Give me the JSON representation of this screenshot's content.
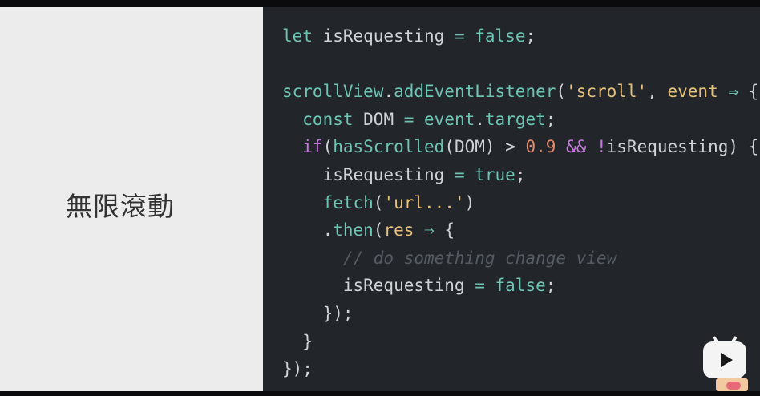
{
  "slide": {
    "title": "無限滾動"
  },
  "code_lines": [
    [
      {
        "t": "let ",
        "c": "kw"
      },
      {
        "t": "isRequesting ",
        "c": "pl"
      },
      {
        "t": "= ",
        "c": "kw"
      },
      {
        "t": "false",
        "c": "kw"
      },
      {
        "t": ";",
        "c": "pl"
      }
    ],
    [],
    [
      {
        "t": "scrollView",
        "c": "kw"
      },
      {
        "t": ".",
        "c": "pl"
      },
      {
        "t": "addEventListener",
        "c": "fn"
      },
      {
        "t": "(",
        "c": "pl"
      },
      {
        "t": "'scroll'",
        "c": "str"
      },
      {
        "t": ", ",
        "c": "pl"
      },
      {
        "t": "event ",
        "c": "str"
      },
      {
        "t": "⇒ ",
        "c": "kw"
      },
      {
        "t": "{",
        "c": "pl"
      }
    ],
    [
      {
        "t": "  const ",
        "c": "kw"
      },
      {
        "t": "DOM ",
        "c": "pl"
      },
      {
        "t": "= ",
        "c": "kw"
      },
      {
        "t": "event",
        "c": "kw"
      },
      {
        "t": ".",
        "c": "pl"
      },
      {
        "t": "target",
        "c": "kw"
      },
      {
        "t": ";",
        "c": "pl"
      }
    ],
    [
      {
        "t": "  if",
        "c": "op"
      },
      {
        "t": "(",
        "c": "pl"
      },
      {
        "t": "hasScrolled",
        "c": "kw"
      },
      {
        "t": "(DOM) ",
        "c": "pl"
      },
      {
        "t": "> ",
        "c": "pl"
      },
      {
        "t": "0.9 ",
        "c": "num"
      },
      {
        "t": "&& ",
        "c": "op"
      },
      {
        "t": "!",
        "c": "op"
      },
      {
        "t": "isRequesting) {",
        "c": "pl"
      }
    ],
    [
      {
        "t": "    isRequesting ",
        "c": "pl"
      },
      {
        "t": "= ",
        "c": "kw"
      },
      {
        "t": "true",
        "c": "kw"
      },
      {
        "t": ";",
        "c": "pl"
      }
    ],
    [
      {
        "t": "    fetch",
        "c": "fn"
      },
      {
        "t": "(",
        "c": "pl"
      },
      {
        "t": "'url...'",
        "c": "str"
      },
      {
        "t": ")",
        "c": "pl"
      }
    ],
    [
      {
        "t": "    .",
        "c": "pl"
      },
      {
        "t": "then",
        "c": "fn"
      },
      {
        "t": "(",
        "c": "pl"
      },
      {
        "t": "res ",
        "c": "str"
      },
      {
        "t": "⇒ ",
        "c": "kw"
      },
      {
        "t": "{",
        "c": "pl"
      }
    ],
    [
      {
        "t": "      // do something change view",
        "c": "cm"
      }
    ],
    [
      {
        "t": "      isRequesting ",
        "c": "pl"
      },
      {
        "t": "= ",
        "c": "kw"
      },
      {
        "t": "false",
        "c": "kw"
      },
      {
        "t": ";",
        "c": "pl"
      }
    ],
    [
      {
        "t": "    });",
        "c": "pl"
      }
    ],
    [
      {
        "t": "  }",
        "c": "pl"
      }
    ],
    [
      {
        "t": "});",
        "c": "pl"
      }
    ]
  ],
  "overlay": {
    "play_icon": "bilibili-tv-play-icon",
    "badge_icon": "mascot-badge-icon"
  }
}
